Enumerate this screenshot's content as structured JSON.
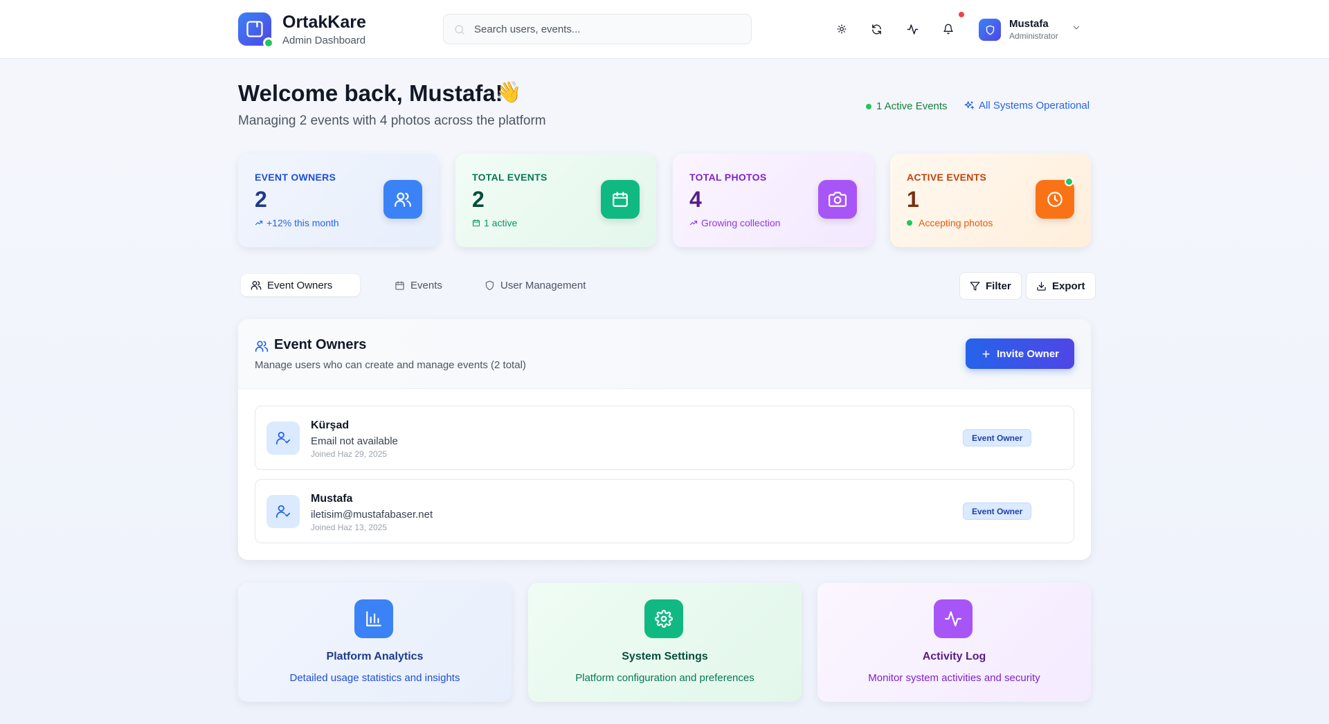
{
  "brand": {
    "name": "OrtakKare",
    "subtitle": "Admin Dashboard"
  },
  "search": {
    "placeholder": "Search users, events..."
  },
  "user": {
    "name": "Mustafa",
    "role": "Administrator"
  },
  "header_icons": [
    "sun-icon",
    "refresh-icon",
    "activity-icon",
    "bell-icon",
    "shield-icon",
    "chevron-down-icon"
  ],
  "welcome": {
    "title": "Welcome back, Mustafa!",
    "emoji": "👋",
    "subtitle": "Managing 2 events with 4 photos across the platform"
  },
  "status": {
    "active_events": "1 Active Events",
    "systems": "All Systems Operational"
  },
  "stats": [
    {
      "label": "EVENT OWNERS",
      "value": "2",
      "sub": "+12% this month",
      "icon": "users-icon",
      "color": "#3b82f6"
    },
    {
      "label": "TOTAL EVENTS",
      "value": "2",
      "sub": "1 active",
      "icon": "calendar-icon",
      "color": "#10b981"
    },
    {
      "label": "TOTAL PHOTOS",
      "value": "4",
      "sub": "Growing collection",
      "icon": "camera-icon",
      "color": "#a855f7"
    },
    {
      "label": "ACTIVE EVENTS",
      "value": "1",
      "sub": "Accepting photos",
      "icon": "clock-icon",
      "color": "#f97316"
    }
  ],
  "tabs": [
    {
      "label": "Event Owners",
      "active": true
    },
    {
      "label": "Events",
      "active": false
    },
    {
      "label": "User Management",
      "active": false
    }
  ],
  "actions": {
    "filter": "Filter",
    "export": "Export"
  },
  "owners_panel": {
    "title": "Event Owners",
    "subtitle": "Manage users who can create and manage events (2 total)",
    "invite_label": "Invite Owner",
    "rows": [
      {
        "name": "Kürşad",
        "email": "Email not available",
        "joined": "Joined Haz 29, 2025",
        "badge": "Event Owner"
      },
      {
        "name": "Mustafa",
        "email": "iletisim@mustafabaser.net",
        "joined": "Joined Haz 13, 2025",
        "badge": "Event Owner"
      }
    ]
  },
  "bottom_cards": [
    {
      "title": "Platform Analytics",
      "desc": "Detailed usage statistics and insights",
      "icon": "bar-chart-icon",
      "color": "#3b82f6"
    },
    {
      "title": "System Settings",
      "desc": "Platform configuration and preferences",
      "icon": "gear-icon",
      "color": "#10b981"
    },
    {
      "title": "Activity Log",
      "desc": "Monitor system activities and security",
      "icon": "activity-icon",
      "color": "#a855f7"
    }
  ]
}
